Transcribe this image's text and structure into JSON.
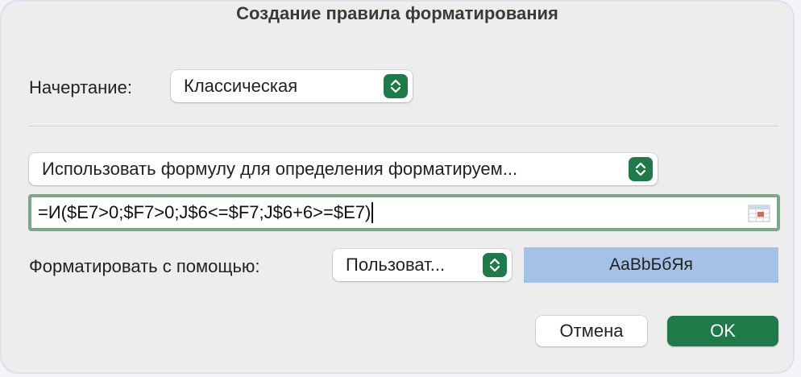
{
  "dialog": {
    "title": "Создание правила форматирования"
  },
  "style_row": {
    "label": "Начертание:",
    "value": "Классическая"
  },
  "rule_type": {
    "value": "Использовать формулу для определения форматируем..."
  },
  "formula": {
    "value": "=И($E7>0;$F7>0;J$6<=$F7;J$6+6>=$E7)"
  },
  "format_row": {
    "label": "Форматировать с помощью:",
    "value": "Пользоват...",
    "preview_text": "AaBbБбЯя",
    "preview_color": "#a4c2e6"
  },
  "buttons": {
    "cancel_label": "Отмена",
    "ok_label": "OK"
  },
  "colors": {
    "accent": "#1f7a4a",
    "focus_ring": "#7aa98a"
  },
  "icons": {
    "stepper": "up-down-chevron-icon",
    "collapse": "collapse-dialog-icon"
  }
}
